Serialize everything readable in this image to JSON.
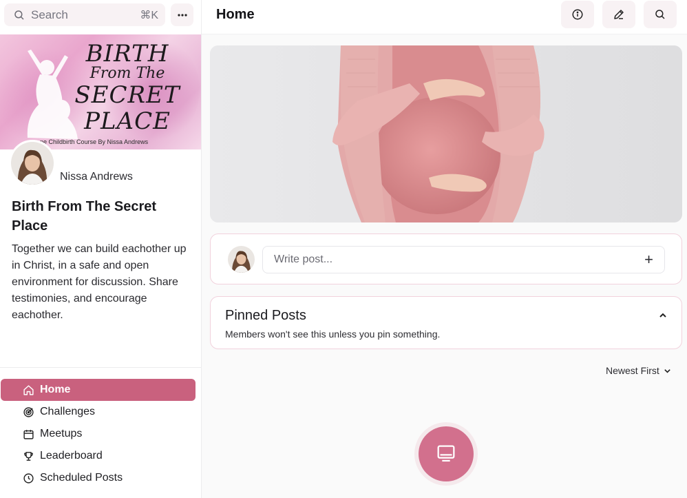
{
  "sidebar": {
    "search": {
      "label": "Search",
      "shortcut": "⌘K"
    },
    "more_button_icon": "more-horizontal-icon",
    "banner": {
      "line1": "BIRTH",
      "line2": "From The",
      "line3": "SECRET",
      "line4": "PLACE",
      "subtitle": "ne Childbirth Course By Nissa Andrews"
    },
    "owner_name": "Nissa Andrews",
    "community_title": "Birth From The Secret Place",
    "community_description": "Together we can build eachother up in Christ, in a safe and open environment for discussion. Share testimonies, and encourage eachother.",
    "nav": [
      {
        "label": "Home",
        "icon": "home-icon",
        "active": true
      },
      {
        "label": "Challenges",
        "icon": "target-icon",
        "active": false
      },
      {
        "label": "Meetups",
        "icon": "calendar-icon",
        "active": false
      },
      {
        "label": "Leaderboard",
        "icon": "trophy-icon",
        "active": false
      },
      {
        "label": "Scheduled Posts",
        "icon": "clock-icon",
        "active": false
      }
    ]
  },
  "header": {
    "title": "Home",
    "buttons": [
      "info-icon",
      "pen-icon",
      "search-icon"
    ]
  },
  "composer": {
    "placeholder": "Write post...",
    "add_icon": "plus-icon"
  },
  "pinned": {
    "title": "Pinned Posts",
    "subtitle": "Members won't see this unless you pin something."
  },
  "sort": {
    "label": "Newest First"
  },
  "empty_state": {
    "icon": "monitor-icon"
  },
  "colors": {
    "accent": "#c9617e",
    "accent_light": "#f8f2f4",
    "border_pink": "#f1d1dc"
  }
}
